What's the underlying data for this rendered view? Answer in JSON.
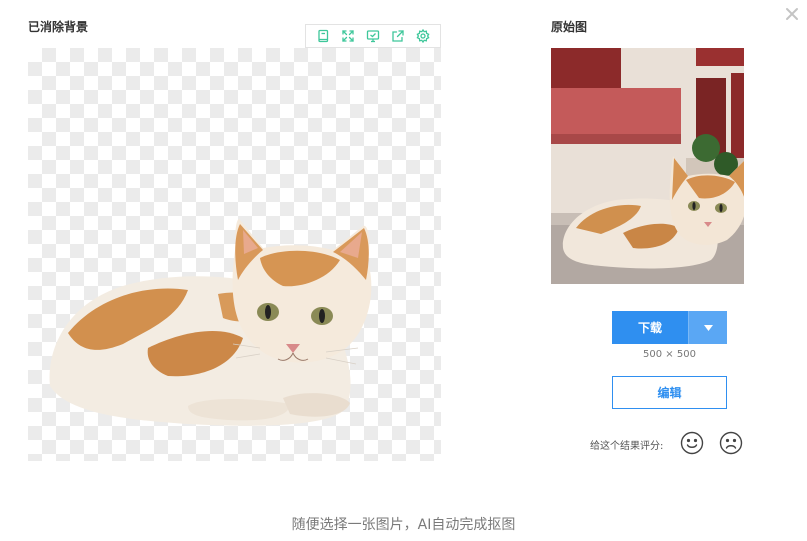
{
  "modal": {
    "close_icon": "close-icon",
    "result_label": "已消除背景",
    "original_label": "原始图"
  },
  "toolbar": {
    "tools": [
      "book-icon",
      "expand-icon",
      "monitor-icon",
      "share-icon",
      "gear-icon"
    ],
    "accent": "#3ec79a"
  },
  "actions": {
    "download_label": "下载",
    "dropdown_icon": "chevron-down-icon",
    "size_text": "500 × 500",
    "edit_label": "编辑",
    "rate_label": "给这个结果评分:",
    "rate_icons": [
      "smile-icon",
      "frown-icon"
    ]
  },
  "caption": "随便选择一张图片，AI自动完成抠图",
  "colors": {
    "primary": "#2f8ff0",
    "primary_light": "#5aa7f4"
  }
}
